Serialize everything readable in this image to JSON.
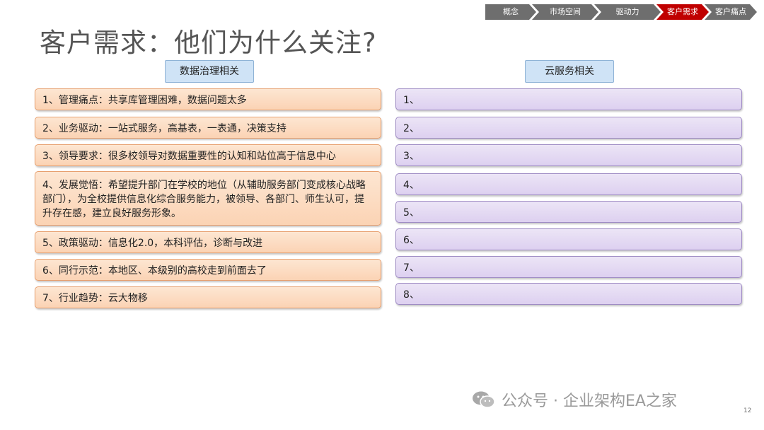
{
  "nav": {
    "steps": [
      {
        "label": "概念",
        "active": false
      },
      {
        "label": "市场空间",
        "active": false
      },
      {
        "label": "驱动力",
        "active": false
      },
      {
        "label": "客户需求",
        "active": true
      },
      {
        "label": "客户痛点",
        "active": false
      }
    ]
  },
  "title": "客户需求：他们为什么关注?",
  "left_column": {
    "header": "数据治理相关",
    "items": [
      "1、管理痛点：共享库管理困难，数据问题太多",
      "2、业务驱动：一站式服务，高基表，一表通，决策支持",
      "3、领导要求：很多校领导对数据重要性的认知和站位高于信息中心",
      "4、发展觉悟：希望提升部门在学校的地位（从辅助服务部门变成核心战略部门），为全校提供信息化综合服务能力，被领导、各部门、师生认可，提升存在感，建立良好服务形象。",
      "5、政策驱动：信息化2.0，本科评估，诊断与改进",
      "6、同行示范：本地区、本级别的高校走到前面去了",
      "7、行业趋势：云大物移"
    ]
  },
  "right_column": {
    "header": "云服务相关",
    "items": [
      "1、",
      "2、",
      "3、",
      "4、",
      "5、",
      "6、",
      "7、",
      "8、"
    ]
  },
  "watermark": "公众号 · 企业架构EA之家",
  "page_number": "12",
  "colors": {
    "nav_active": "#c00000",
    "nav_default": "#6e6e6e",
    "left_box": "#fbd3b4",
    "right_box": "#ddd0f0",
    "header_box": "#cfe3f6"
  }
}
